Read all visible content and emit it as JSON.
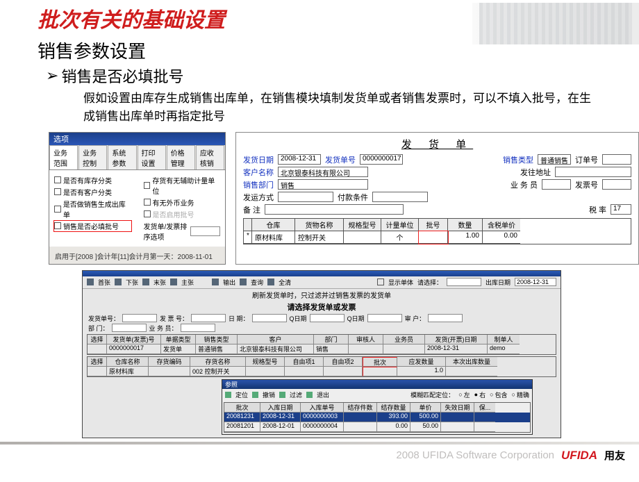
{
  "slide": {
    "title": "批次有关的基础设置",
    "section": "销售参数设置",
    "bullet": "销售是否必填批号",
    "paragraph": "假如设置由库存生成销售出库单，在销售模块填制发货单或者销售发票时，可以不填入批号，在生成销售出库单时再指定批号"
  },
  "options_panel": {
    "window_title": "选项",
    "tabs": [
      "业务范围",
      "业务控制",
      "系统参数",
      "打印设置",
      "价格管理",
      "应收核销"
    ],
    "left_checks": [
      "是否有库存分类",
      "是否有客户分类",
      "是否做销售生成出库单",
      "销售是否必填批号"
    ],
    "right_checks": [
      "存货有无辅助计量单位",
      "有无外币业务",
      "是否启用批号",
      "发货单/发票排序选项"
    ],
    "footer": "启用于[2008 ]会计年[11]会计月第一天：2008-11-01"
  },
  "invoice": {
    "title": "发 货 单",
    "fields": {
      "date_lbl": "发货日期",
      "date_val": "2008-12-31",
      "no_lbl": "发货单号",
      "no_val": "0000000017",
      "type_lbl": "销售类型",
      "type_val": "普通销售",
      "order_lbl": "订单号",
      "cust_lbl": "客户名称",
      "cust_val": "北京银泰科技有限公司",
      "addr_lbl": "发往地址",
      "dept_lbl": "销售部门",
      "dept_val": "销售",
      "sales_lbl": "业 务 员",
      "inv_lbl": "发票号",
      "ship_lbl": "发运方式",
      "pay_lbl": "付款条件",
      "remark_lbl": "备    注",
      "tax_lbl": "税    率",
      "tax_val": "17"
    },
    "grid": {
      "headers": [
        "",
        "仓库",
        "货物名称",
        "规格型号",
        "计量单位",
        "批号",
        "数量",
        "含税单价"
      ],
      "row": [
        "*",
        "原材料库",
        "控制开关",
        "",
        "个",
        "",
        "1.00",
        "0.00"
      ]
    }
  },
  "bottom": {
    "toolbar1": [
      "首张",
      "下张",
      "末张",
      "主张",
      "输出",
      "查询",
      "全清"
    ],
    "toolbar_r": [
      "显示单体",
      "请选择：",
      "",
      "出库日期",
      "2008-12-31"
    ],
    "note": "刷新发货单时，只过滤并过销售发票的发货单",
    "hint": "请选择发货单或发票",
    "filter1": {
      "a": "发货单号：",
      "b": "发 票 号：",
      "c": "日    期：",
      "d": "Q日期",
      "e": "Q日期",
      "f": "审    户："
    },
    "filter2": {
      "a": "部    门：",
      "b": "业 务 员："
    },
    "tbl1_head": [
      "选择",
      "发货单(发票)号",
      "单据类型",
      "销售类型",
      "客户",
      "部门",
      "审核人",
      "业务员",
      "发货(开票)日期",
      "制单人"
    ],
    "tbl1_row": [
      "",
      "0000000017",
      "发货单",
      "普通销售",
      "北京银泰科技有限公司",
      "销售",
      "",
      "",
      "2008-12-31",
      "demo"
    ],
    "tbl2_head": [
      "选择",
      "仓库名称",
      "存货编码",
      "存货名称",
      "规格型号",
      "自由项1",
      "自由项2",
      "批次",
      "应发数量",
      "本次出库数量"
    ],
    "tbl2_row": [
      "",
      "原材料库",
      "",
      "002 控制开关",
      "",
      "",
      "",
      "",
      "1.0",
      ""
    ],
    "popup": {
      "title": "参照",
      "tb": [
        "定位",
        "撤销",
        "过滤",
        "退出"
      ],
      "tb_r": "模糊匹配定位：",
      "radios": [
        "左",
        "右",
        "包含",
        "精确"
      ],
      "head": [
        "批次",
        "入库日期",
        "入库单号",
        "结存件数",
        "结存数量",
        "单价",
        "失效日期",
        "保..."
      ],
      "r1": [
        "20081231",
        "2008-12-31",
        "0000000003",
        "",
        "393.00",
        "500.00",
        "",
        ""
      ],
      "r2": [
        "20081201",
        "2008-12-01",
        "0000000004",
        "",
        "0.00",
        "50.00",
        "",
        ""
      ]
    }
  },
  "footer": {
    "corp": "2008 UFIDA Software Corporation",
    "logo": "UFIDA",
    "cn": "用友"
  }
}
